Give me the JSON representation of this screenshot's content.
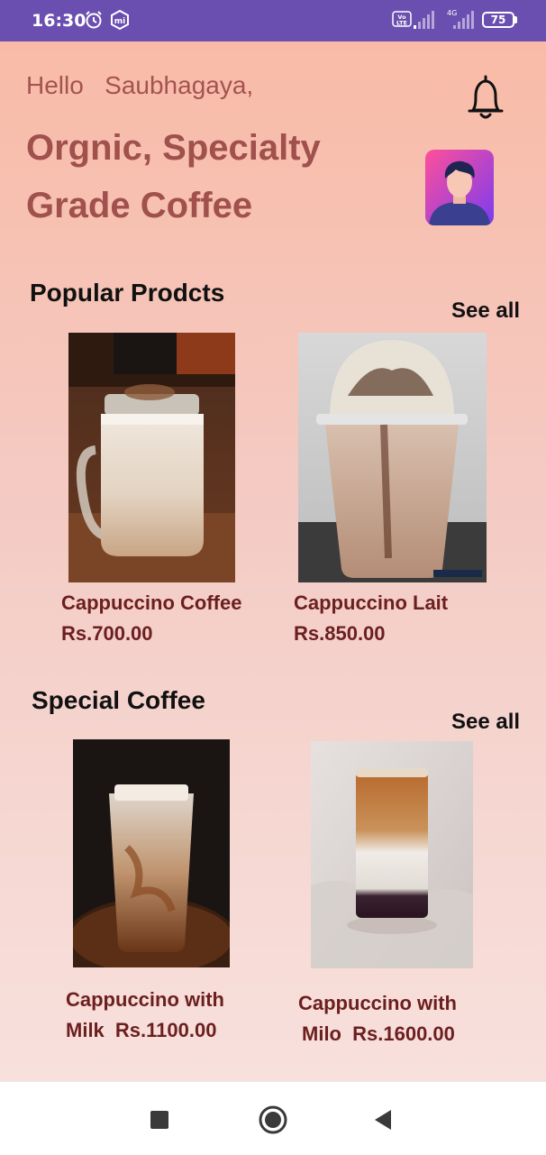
{
  "status_bar": {
    "time": "16:30",
    "battery": "75",
    "network_label": "4G",
    "volte_label": "VoLTE"
  },
  "header": {
    "greeting": "Hello",
    "user_name": "Saubhagaya,",
    "headline": "Orgnic, Specialty Grade Coffee"
  },
  "popular": {
    "title": "Popular Prodcts",
    "see_all": "See all",
    "items": [
      {
        "name": "Cappuccino Coffee",
        "price": "Rs.700.00"
      },
      {
        "name": "Cappuccino Lait",
        "price": "Rs.850.00"
      }
    ]
  },
  "special": {
    "title": "Special Coffee",
    "see_all": "See all",
    "items": [
      {
        "name_line1": "Cappuccino with",
        "name_line2": "Milk",
        "price": "Rs.1100.00"
      },
      {
        "name_line1": "Cappuccino with",
        "name_line2": "Milo",
        "price": "Rs.1600.00"
      }
    ]
  },
  "nav": {
    "icons": [
      "square-recents-icon",
      "circle-home-icon",
      "triangle-back-icon"
    ]
  },
  "colors": {
    "status_bar": "#6a4fb0",
    "accent_text": "#a0504d",
    "price_text": "#6b1f1f",
    "gradient_top": "#f9bba7",
    "gradient_bottom": "#f8e0dc"
  }
}
